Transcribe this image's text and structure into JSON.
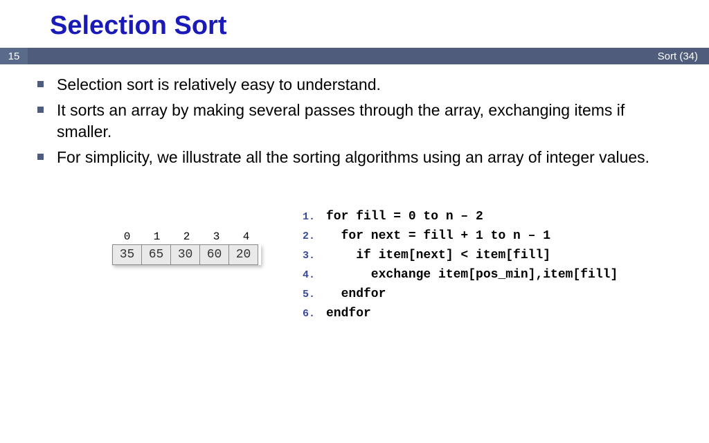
{
  "title": "Selection Sort",
  "pageNumber": "15",
  "headerRight": "Sort (34)",
  "bullets": [
    "Selection sort is relatively easy to understand.",
    "It sorts an array by making several passes through the array, exchanging items if smaller.",
    "For simplicity, we illustrate all the sorting algorithms using an array of integer values."
  ],
  "array": {
    "indices": [
      "0",
      "1",
      "2",
      "3",
      "4"
    ],
    "values": [
      "35",
      "65",
      "30",
      "60",
      "20"
    ]
  },
  "pseudo": [
    {
      "n": "1.",
      "c": "for fill = 0 to n – 2"
    },
    {
      "n": "2.",
      "c": "  for next = fill + 1 to n – 1"
    },
    {
      "n": "3.",
      "c": "    if item[next] < item[fill]"
    },
    {
      "n": "4.",
      "c": "      exchange item[pos_min],item[fill]"
    },
    {
      "n": "5.",
      "c": "  endfor"
    },
    {
      "n": "6.",
      "c": "endfor"
    }
  ]
}
